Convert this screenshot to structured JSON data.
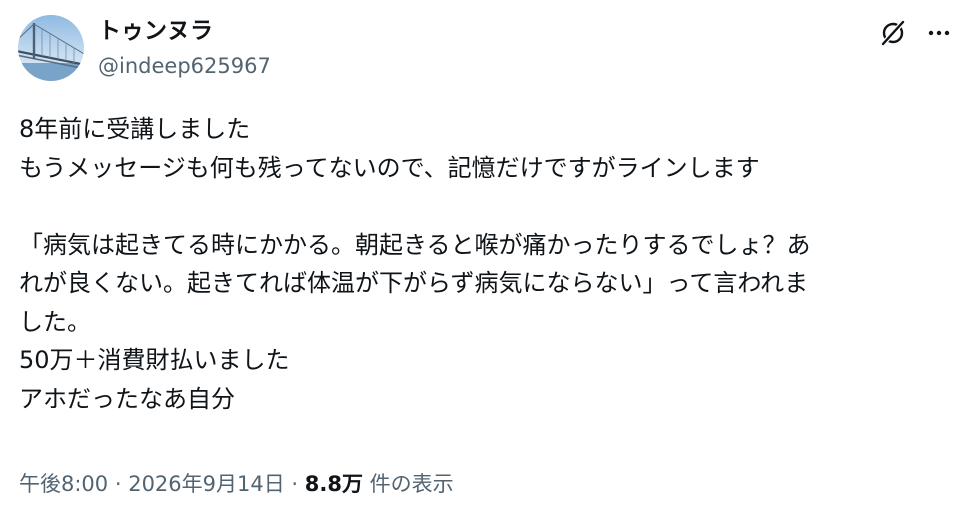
{
  "author": {
    "display_name": "トゥンヌラ",
    "handle": "@indeep625967"
  },
  "icons": {
    "avatar": "avatar-bridge-photo",
    "grok": "grok-icon",
    "more": "more-icon"
  },
  "tweet": {
    "lines": [
      "8年前に受講しました",
      "もうメッセージも何も残ってないので、記憶だけですがラインします",
      "",
      "「病気は起きてる時にかかる。朝起きると喉が痛かったりするでしょ？あ",
      "れが良くない。起きてれば体温が下がらず病気にならない」って言われま",
      "した。",
      "50万＋消費財払いました",
      "アホだったなあ自分"
    ]
  },
  "meta": {
    "time": "午後8:00",
    "separator": " · ",
    "date": "2026年9月14日",
    "views_count": "8.8万",
    "views_label": "件の表示"
  },
  "colors": {
    "text": "#0f1419",
    "secondary": "#536471",
    "background": "#ffffff"
  }
}
